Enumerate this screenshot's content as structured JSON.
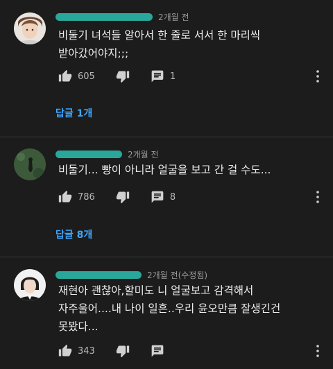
{
  "comments": [
    {
      "time": "2개월 전",
      "text": "비둘기 녀석들 알아서 한 줄로 서서 한 마리씩\n받아갔어야지;;;",
      "likes": "605",
      "reply_count": "1",
      "replies_label": "답글 1개"
    },
    {
      "time": "2개월 전",
      "text": "비둘기... 빵이 아니라 얼굴을 보고 간 걸 수도...",
      "likes": "786",
      "reply_count": "8",
      "replies_label": "답글 8개"
    },
    {
      "time": "2개월 전(수정됨)",
      "text": "재현아 괜찮아,할미도 니 얼굴보고 감격해서\n자주울어....내 나이 일흔..우리 윤오만큼 잘생긴건\n못봤다...",
      "likes": "343",
      "reply_count": ""
    }
  ],
  "colors": {
    "background": "#1c1c1c",
    "accent_link": "#3ea6ff",
    "redaction": "#2aa79b"
  },
  "icons": [
    "like-icon",
    "dislike-icon",
    "reply-icon",
    "more-vert-icon"
  ]
}
